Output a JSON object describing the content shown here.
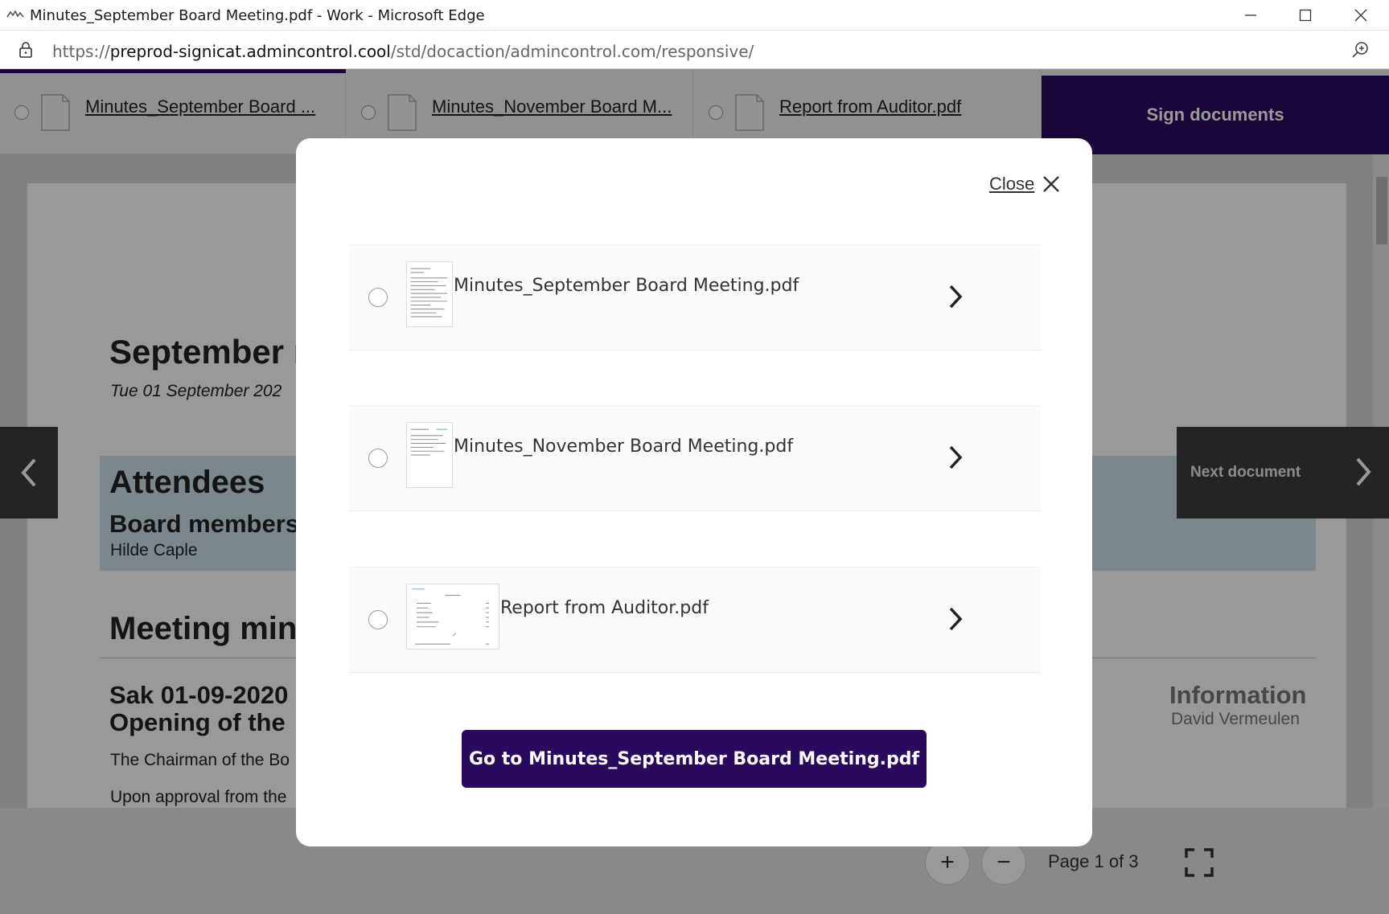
{
  "window": {
    "title": "Minutes_September Board Meeting.pdf - Work - Microsoft Edge",
    "url_scheme": "https://",
    "url_domain": "preprod-signicat.admincontrol.cool",
    "url_path": "/std/docaction/admincontrol.com/responsive/"
  },
  "tabs": [
    {
      "label": "Minutes_September Board ..."
    },
    {
      "label": "Minutes_November Board M..."
    },
    {
      "label": "Report from Auditor.pdf"
    }
  ],
  "sign_button": "Sign documents",
  "document": {
    "title": "September m",
    "date": "Tue 01 September 202",
    "attendees_heading": "Attendees",
    "board_members_heading": "Board members",
    "attendee_name": "Hilde Caple",
    "minutes_heading": "Meeting min",
    "item_heading_1": "Sak 01-09-2020",
    "item_heading_2": "Opening of the",
    "para_1": "The Chairman of the Bo",
    "para_2": "Upon approval from the",
    "info_heading": "Information",
    "info_name": "David Vermeulen"
  },
  "nav": {
    "next_label": "Next document"
  },
  "toolbar": {
    "zoom_in": "+",
    "zoom_out": "−",
    "page_indicator": "Page 1 of 3"
  },
  "modal": {
    "close_label": "Close",
    "documents": [
      {
        "name": "Minutes_September Board Meeting.pdf"
      },
      {
        "name": "Minutes_November Board Meeting.pdf"
      },
      {
        "name": "Report from Auditor.pdf"
      }
    ],
    "go_button": "Go to Minutes_September Board Meeting.pdf"
  },
  "colors": {
    "brand_purple": "#2a0a5e",
    "nav_dark": "#3d3d3d",
    "attendee_band": "#cfe0ec"
  }
}
